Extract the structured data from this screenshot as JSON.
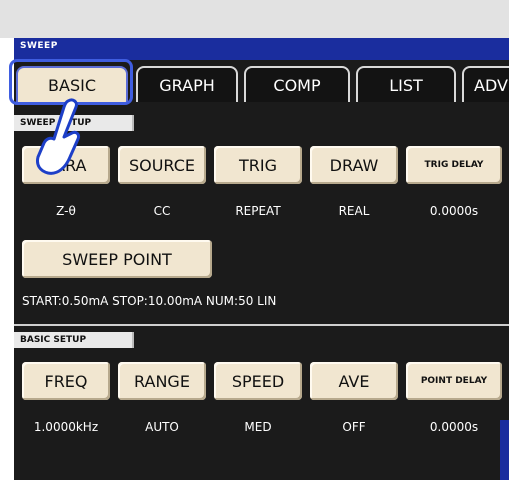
{
  "window": {
    "title": "SWEEP"
  },
  "tabs": [
    {
      "label": "BASIC"
    },
    {
      "label": "GRAPH"
    },
    {
      "label": "COMP"
    },
    {
      "label": "LIST"
    },
    {
      "label": "ADV"
    }
  ],
  "sweep_setup": {
    "label": "SWEEP SETUP",
    "buttons": [
      {
        "label": "PARA",
        "value": "Z-θ"
      },
      {
        "label": "SOURCE",
        "value": "CC"
      },
      {
        "label": "TRIG",
        "value": "REPEAT"
      },
      {
        "label": "DRAW",
        "value": "REAL"
      },
      {
        "label": "TRIG DELAY",
        "value": "0.0000s"
      }
    ],
    "sweep_point": {
      "label": "SWEEP POINT",
      "info": "START:0.50mA STOP:10.00mA NUM:50 LIN"
    }
  },
  "basic_setup": {
    "label": "BASIC SETUP",
    "buttons": [
      {
        "label": "FREQ",
        "value": "1.0000kHz"
      },
      {
        "label": "RANGE",
        "value": "AUTO"
      },
      {
        "label": "SPEED",
        "value": "MED"
      },
      {
        "label": "AVE",
        "value": "OFF"
      },
      {
        "label": "POINT DELAY",
        "value": "0.0000s"
      }
    ]
  },
  "icons": {
    "pointer": "hand-pointer-icon"
  }
}
